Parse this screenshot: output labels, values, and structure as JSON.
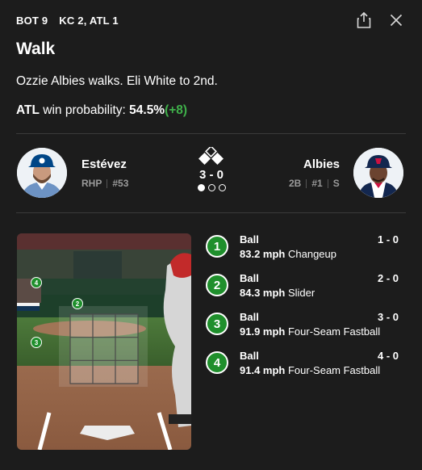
{
  "header": {
    "inning": "BOT 9",
    "score": "KC 2, ATL 1"
  },
  "play": {
    "title": "Walk",
    "description": "Ozzie Albies walks. Eli White to 2nd.",
    "win_prob_team": "ATL",
    "win_prob_label": "win probability:",
    "win_prob_value": "54.5%",
    "win_prob_delta": "(+8)"
  },
  "pitcher": {
    "name": "Estévez",
    "hand": "RHP",
    "number": "#53"
  },
  "batter": {
    "name": "Albies",
    "position": "2B",
    "number": "#1",
    "bats": "S"
  },
  "situation": {
    "count": "3 - 0",
    "outs_filled": 1,
    "outs_total": 3
  },
  "pitches": [
    {
      "num": "1",
      "result": "Ball",
      "count": "1 - 0",
      "speed": "83.2 mph",
      "type": "Changeup"
    },
    {
      "num": "2",
      "result": "Ball",
      "count": "2 - 0",
      "speed": "84.3 mph",
      "type": "Slider"
    },
    {
      "num": "3",
      "result": "Ball",
      "count": "3 - 0",
      "speed": "91.9 mph",
      "type": "Four-Seam Fastball"
    },
    {
      "num": "4",
      "result": "Ball",
      "count": "4 - 0",
      "speed": "91.4 mph",
      "type": "Four-Seam Fastball"
    }
  ],
  "zone_markers": [
    "4",
    "2",
    "3"
  ],
  "colors": {
    "background": "#1c1c1c",
    "pitch_ball": "#1f8f2c",
    "delta": "#3fb04a",
    "kc_blue": "#004687",
    "atl_navy": "#13274f",
    "atl_red": "#ce1141"
  }
}
